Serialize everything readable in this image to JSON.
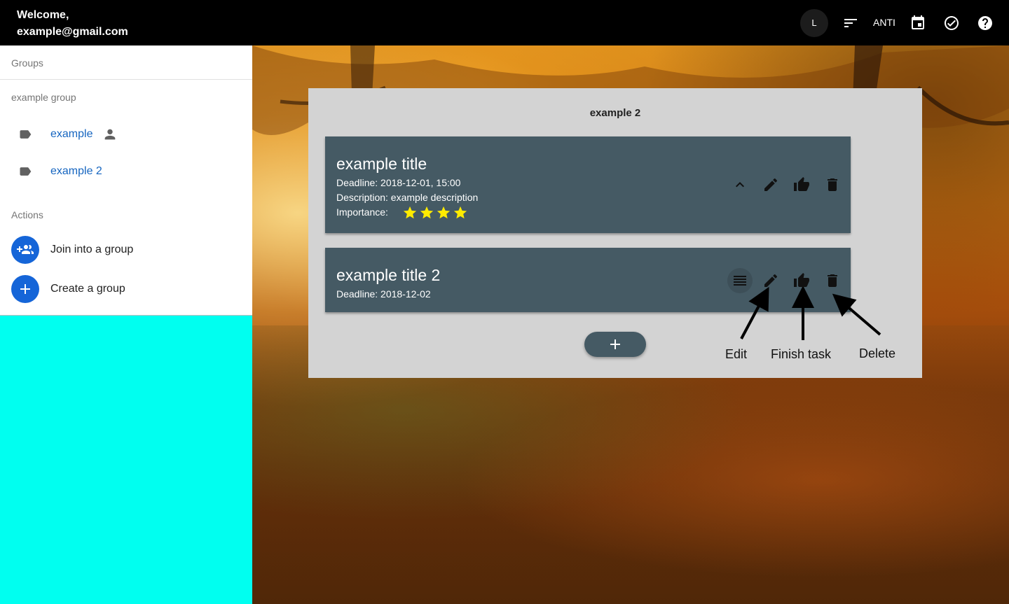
{
  "header": {
    "welcome_line1": "Welcome,",
    "welcome_line2": "example@gmail.com",
    "avatar_letter": "L",
    "filter_text": "ANTI",
    "icons": [
      "sort-icon",
      "calendar-icon",
      "check-circle-icon",
      "help-icon"
    ]
  },
  "sidebar": {
    "groups_heading": "Groups",
    "group_section_name": "example group",
    "groups": [
      {
        "label": "example",
        "icon": "label-icon",
        "owner_icon": "person-icon"
      },
      {
        "label": "example 2",
        "icon": "label-icon"
      }
    ],
    "actions_heading": "Actions",
    "actions": [
      {
        "label": "Join into a group",
        "icon": "group-add-icon"
      },
      {
        "label": "Create a group",
        "icon": "plus-icon"
      }
    ]
  },
  "main": {
    "group_title": "example 2",
    "tasks": [
      {
        "title": "example title",
        "deadline": "Deadline: 2018-12-01, 15:00",
        "description": "Description: example description",
        "importance_label": "Importance:",
        "importance": 4,
        "expanded": true
      },
      {
        "title": "example title 2",
        "deadline": "Deadline: 2018-12-02",
        "expanded": false
      }
    ],
    "annotations": {
      "edit": "Edit",
      "finish": "Finish task",
      "delete": "Delete"
    }
  },
  "colors": {
    "topbar": "#000000",
    "accent": "#1565d8",
    "link": "#1565c0",
    "task_card": "#455a64",
    "panel": "#d3d3d3",
    "sidebar_filler": "#00fff0",
    "star": "#ffeb00"
  }
}
